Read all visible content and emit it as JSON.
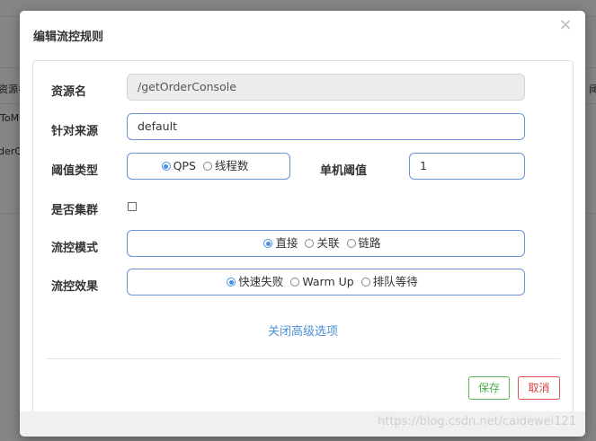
{
  "background": {
    "left_texts": [
      "资源名",
      "ToM",
      "derC"
    ],
    "right_text": "阈"
  },
  "dialog": {
    "title": "编辑流控规则",
    "close_symbol": "×"
  },
  "form": {
    "resource": {
      "label": "资源名",
      "value": "/getOrderConsole"
    },
    "limit_app": {
      "label": "针对来源",
      "value": "default"
    },
    "grade": {
      "label": "阈值类型",
      "options": [
        "QPS",
        "线程数"
      ],
      "selected": "QPS"
    },
    "count": {
      "label": "单机阈值",
      "value": "1"
    },
    "cluster": {
      "label": "是否集群",
      "checked": false
    },
    "strategy": {
      "label": "流控模式",
      "options": [
        "直接",
        "关联",
        "链路"
      ],
      "selected": "直接"
    },
    "control_behavior": {
      "label": "流控效果",
      "options": [
        "快速失败",
        "Warm Up",
        "排队等待"
      ],
      "selected": "快速失败"
    }
  },
  "advanced_link": "关闭高级选项",
  "buttons": {
    "save": "保存",
    "cancel": "取消"
  },
  "watermark": "https://blog.csdn.net/caidewei121",
  "colors": {
    "accent": "#4a90e2",
    "save": "#5cb85c",
    "cancel": "#d9534f",
    "link": "#4a8fd6"
  }
}
